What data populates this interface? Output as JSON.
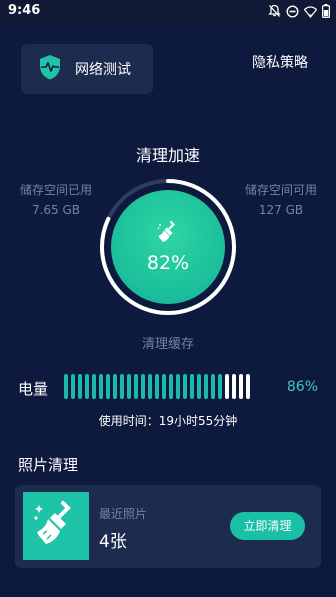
{
  "status_bar": {
    "time": "9:46",
    "icons": [
      "notifications-off-icon",
      "do-not-disturb-icon",
      "wifi-icon",
      "battery-icon"
    ]
  },
  "header": {
    "network_test_label": "网络测试",
    "privacy_label": "隐私策略"
  },
  "speedup": {
    "title": "清理加速",
    "storage_used_label": "储存空间已用",
    "storage_used_value": "7.65 GB",
    "storage_available_label": "储存空间可用",
    "storage_available_value": "127 GB",
    "percent_text": "82%",
    "percent_value": 0.82,
    "cache_label": "清理缓存"
  },
  "battery": {
    "label": "电量",
    "percent_text": "86%",
    "level": 0.86,
    "usage_text": "使用时间：19小时55分钟"
  },
  "photo_clean": {
    "section_title": "照片清理",
    "recent_label": "最近照片",
    "count": "4张",
    "clean_button": "立即清理"
  },
  "colors": {
    "background": "#0e1a3d",
    "card": "#1d2b4e",
    "accent": "#1bb9ac",
    "muted_text": "#6f84ab"
  }
}
